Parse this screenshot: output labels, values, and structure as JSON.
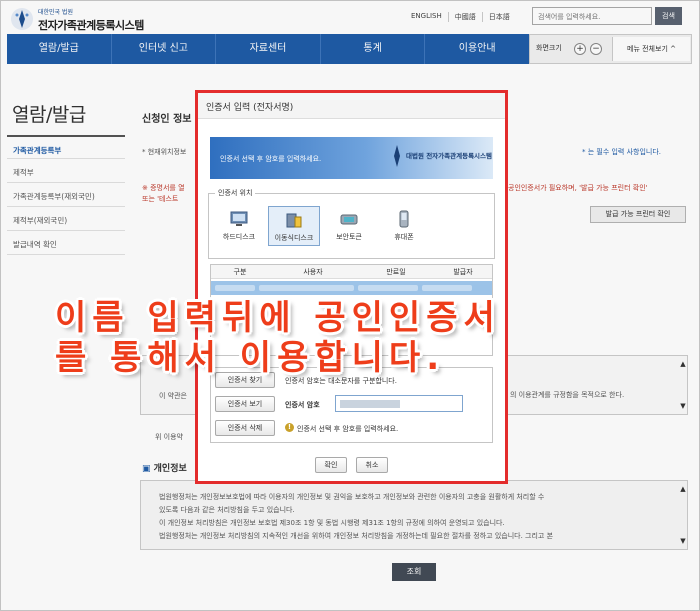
{
  "header": {
    "logo_small": "대한민국 법원",
    "logo_title": "전자가족관계등록시스템",
    "links": [
      "ENGLISH",
      "中國語",
      "日本語"
    ],
    "search_placeholder": "검색어를 입력하세요.",
    "search_button": "검색"
  },
  "nav": {
    "items": [
      "열람/발급",
      "인터넷 신고",
      "자료센터",
      "통계",
      "이용안내"
    ],
    "zoom_label": "화면크기",
    "zoom_in": "+",
    "zoom_out": "−",
    "menu_all": "메뉴 전체보기 ^"
  },
  "sidebar": {
    "title": "열람/발급",
    "items": [
      "가족관계등록부",
      "제적부",
      "가족관계등록부(재외국민)",
      "제적부(재외국민)",
      "발급내역 확인"
    ]
  },
  "main": {
    "title": "신청인 정보",
    "note_left": "* 현재위치정보",
    "note_right": "* 는 필수 입력 사항입니다.",
    "warn_line1": "※ 증명서를 열",
    "warn_line2": "또는 '테스트 ",
    "warn_right": "공인인증서가 필요하며, '발급 가능 프린터 확인'",
    "printer_button": "발급 가능 프린터 확인",
    "terms_left": "이 약관은",
    "terms_right": "의 이용관계를 규정함을 목적으로 한다.",
    "agree_text": "위 이용약",
    "privacy_title": "개인정보",
    "privacy_lines": [
      "법원행정처는 개인정보보호법에 따라 이용자의 개인정보 및 권익을 보호하고 개인정보와 관련한 이용자의 고충을 원활하게 처리할 수",
      "있도록 다음과 같은 처리방침을 두고 있습니다.",
      "이 개인정보 처리방침은 개인정보 보호법 제30조 1항 및 동법 시행령 제31조 1항의 규정에 의하여 운영되고 있습니다.",
      "법원행정처는 개인정보 처리방침의 지속적인 개선을 위하여 개인정보 처리방침을 개정하는데 필요한 절차를 정하고 있습니다. 그리고 본"
    ],
    "lookup_button": "조회"
  },
  "dialog": {
    "title": "인증서 입력 (전자서명)",
    "banner_text": "인증서 선택 후 암호를 입력하세요.",
    "banner_org": "대법원 전자가족관계등록시스템",
    "location_legend": "인증서 위치",
    "locations": [
      "하드디스크",
      "이동식디스크",
      "보안토큰",
      "휴대폰"
    ],
    "table_headers": [
      "구분",
      "사용자",
      "만료일",
      "발급자"
    ],
    "find_button": "인증서 찾기",
    "view_button": "인증서 보기",
    "delete_button": "인증서 삭제",
    "case_note": "인증서 암호는 대소문자를 구분합니다.",
    "password_label": "인증서 암호",
    "select_note": "인증서 선택 후 암호를 입력하세요.",
    "ok_button": "확인",
    "cancel_button": "취소"
  },
  "caption": {
    "line1": "이름 입력뒤에 공인인증서",
    "line2": "를 통해서 이용합니다."
  },
  "colors": {
    "nav_bg": "#1f5ca8",
    "dialog_border": "#e32c2c",
    "caption": "#ee3d1a"
  }
}
